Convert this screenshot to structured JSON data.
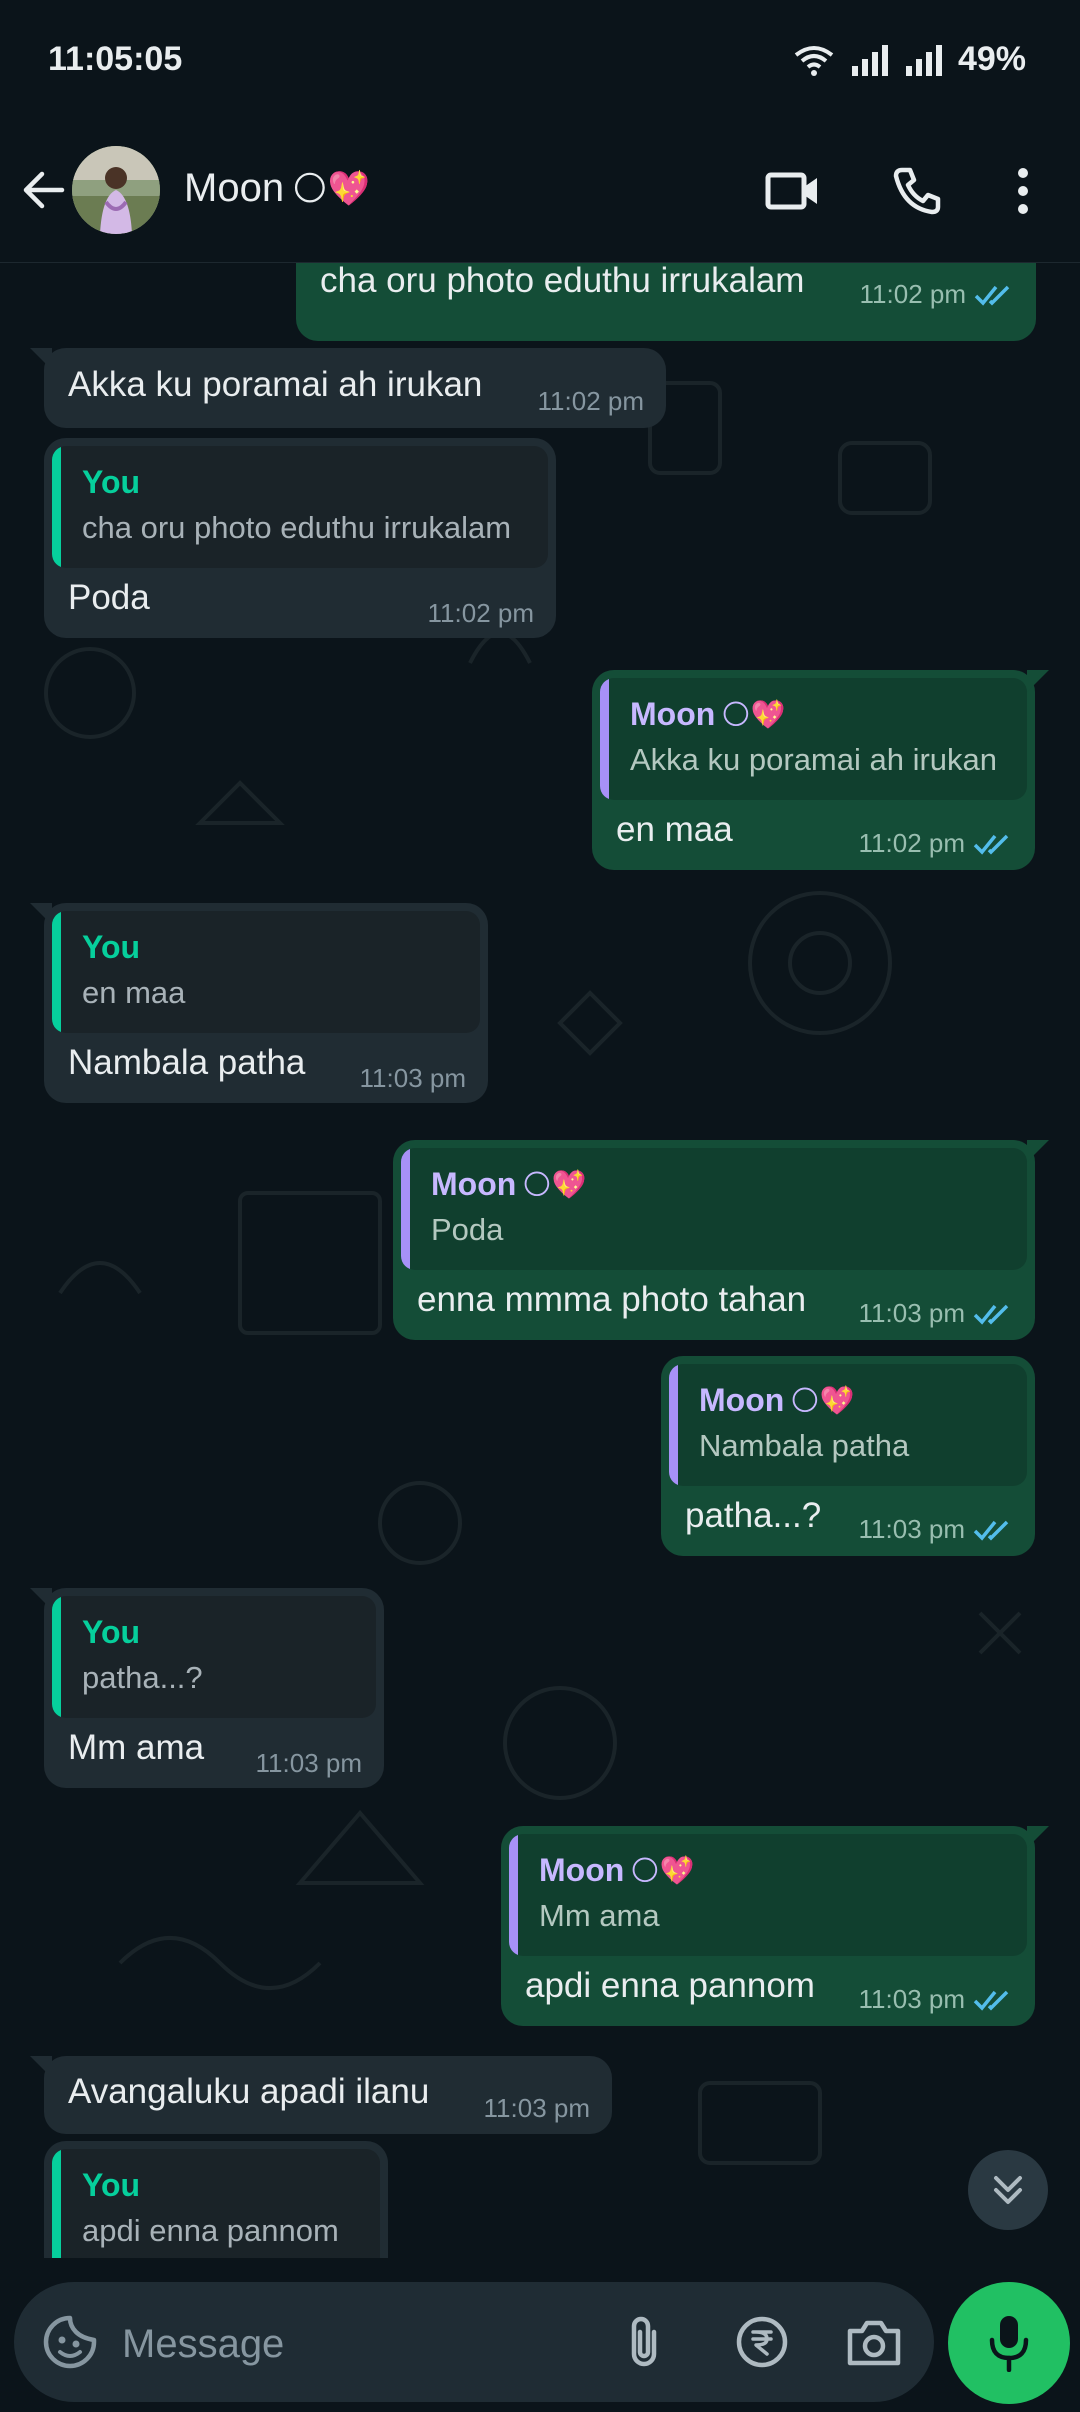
{
  "status_bar": {
    "time": "11:05:05",
    "battery": "49%"
  },
  "contact": {
    "name": "Moon",
    "emoji": "🌕💖"
  },
  "messages": [
    {
      "text": "cha oru photo eduthu irrukalam",
      "time": "11:02 pm"
    },
    {
      "text": "Akka ku poramai ah irukan",
      "time": "11:02 pm"
    },
    {
      "quote_author": "You",
      "quote_text": "cha oru photo eduthu irrukalam",
      "text": "Poda",
      "time": "11:02 pm"
    },
    {
      "quote_author": "Moon",
      "quote_text": "Akka ku poramai ah irukan",
      "text": "en maa",
      "time": "11:02 pm"
    },
    {
      "quote_author": "You",
      "quote_text": "en maa",
      "text": "Nambala patha",
      "time": "11:03 pm"
    },
    {
      "quote_author": "Moon",
      "quote_text": "Poda",
      "text": "enna mmma photo tahan",
      "time": "11:03 pm"
    },
    {
      "quote_author": "Moon",
      "quote_text": "Nambala patha",
      "text": "patha...?",
      "time": "11:03 pm"
    },
    {
      "quote_author": "You",
      "quote_text": "patha...?",
      "text": "Mm ama",
      "time": "11:03 pm"
    },
    {
      "quote_author": "Moon",
      "quote_text": "Mm ama",
      "text": "apdi enna pannom",
      "time": "11:03 pm"
    },
    {
      "text": "Avangaluku apadi ilanu",
      "time": "11:03 pm"
    },
    {
      "quote_author": "You",
      "quote_text": "apdi enna pannom"
    }
  ],
  "composer": {
    "placeholder": "Message"
  },
  "icons": {
    "back": "arrow-left-icon",
    "video": "video-camera-icon",
    "call": "phone-icon",
    "menu": "more-vertical-icon",
    "emoji": "sticker-icon",
    "attach": "paperclip-icon",
    "payment": "rupee-icon",
    "camera": "camera-icon",
    "mic": "microphone-icon",
    "read_receipt": "double-check-icon",
    "scroll": "double-chevron-down-icon"
  },
  "colors": {
    "background": "#0b141a",
    "incoming": "#202c33",
    "outgoing": "#144d37",
    "accent": "#21c063",
    "tick": "#53bdeb"
  }
}
